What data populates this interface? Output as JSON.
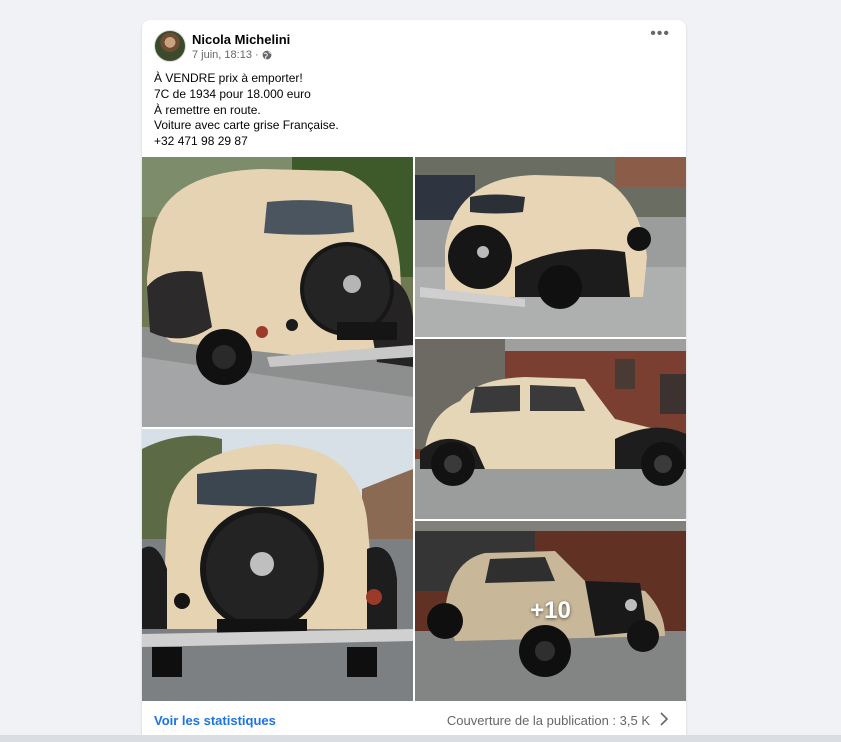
{
  "post": {
    "author": "Nicola Michelini",
    "timestamp": "7 juin, 18:13 ·",
    "privacy_icon": "globe-icon",
    "more_options_label": "•••",
    "text_lines": [
      "À VENDRE prix à emporter!",
      "7C de 1934 pour 18.000 euro",
      "À remettre en route.",
      "Voiture avec carte grise Française.",
      "+32 471 98 29 87"
    ],
    "more_photos": "+10"
  },
  "footer": {
    "stats_link": "Voir les statistiques",
    "reach": "Couverture de la publication : 3,5 K"
  },
  "colors": {
    "link": "#1b74e4",
    "secondary_text": "#65676b",
    "background": "#f0f2f5",
    "card": "#ffffff"
  }
}
